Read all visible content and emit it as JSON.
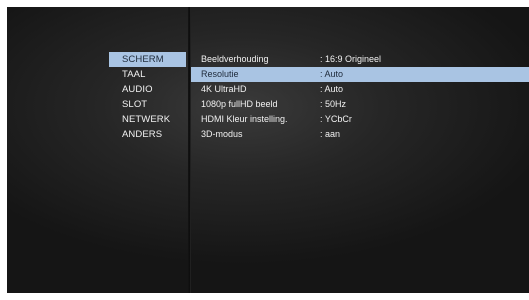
{
  "menu": {
    "categories": [
      {
        "label": "SCHERM",
        "selected": true
      },
      {
        "label": "TAAL",
        "selected": false
      },
      {
        "label": "AUDIO",
        "selected": false
      },
      {
        "label": "SLOT",
        "selected": false
      },
      {
        "label": "NETWERK",
        "selected": false
      },
      {
        "label": "ANDERS",
        "selected": false
      }
    ],
    "settings": [
      {
        "label": "Beeldverhouding",
        "value": ": 16:9 Origineel",
        "selected": false
      },
      {
        "label": "Resolutie",
        "value": ": Auto",
        "selected": true
      },
      {
        "label": "4K UltraHD",
        "value": ": Auto",
        "selected": false
      },
      {
        "label": "1080p fullHD beeld",
        "value": ": 50Hz",
        "selected": false
      },
      {
        "label": "HDMI Kleur instelling.",
        "value": ": YCbCr",
        "selected": false
      },
      {
        "label": "3D-modus",
        "value": ": aan",
        "selected": false
      }
    ]
  },
  "colors": {
    "highlight": "#a9c4e3",
    "text": "#f2f2f2",
    "background": "#262626"
  }
}
